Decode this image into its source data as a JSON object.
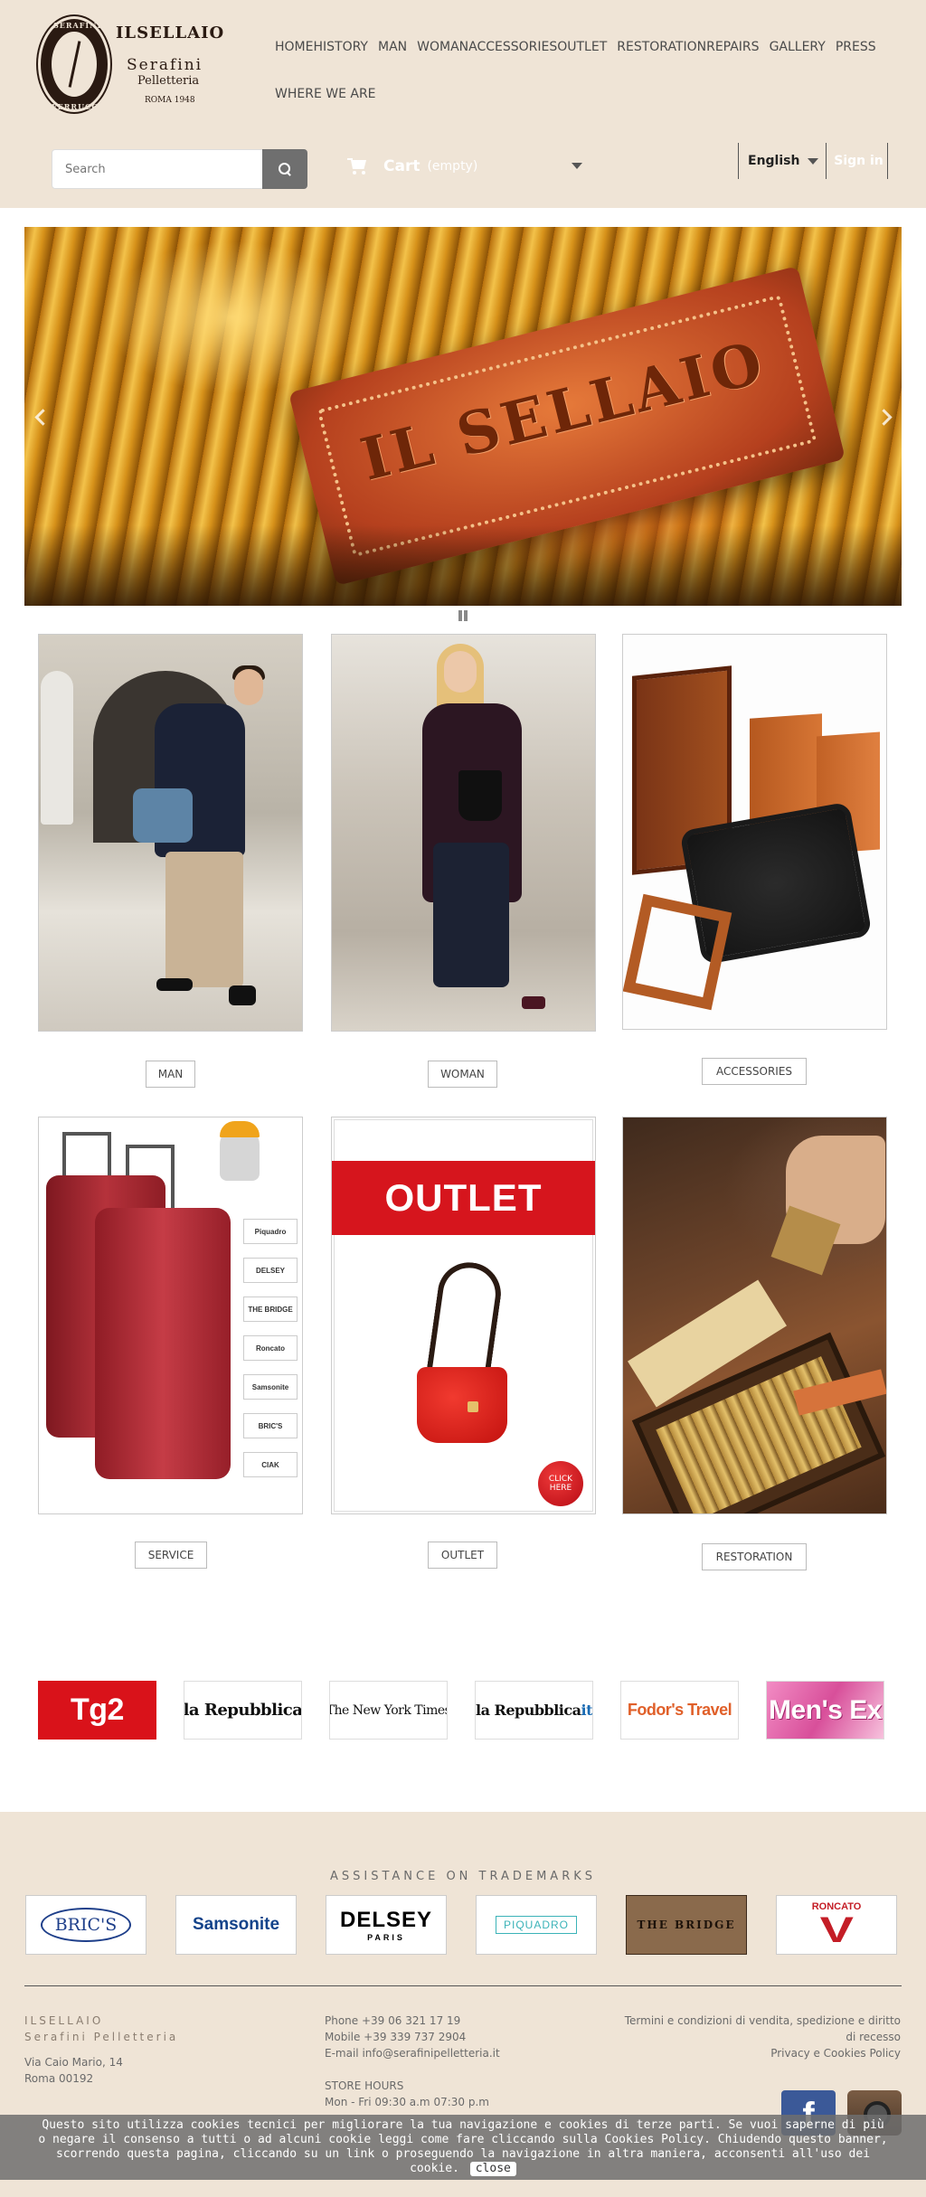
{
  "header": {
    "logo": {
      "brand": "ILSELLAIO",
      "seal_top": "SERAFINI",
      "seal_bottom": "FERRUCCIO",
      "sub1": "Serafini",
      "sub2": "Pelletteria",
      "sub3": "ROMA 1948"
    },
    "nav_row1": [
      "HOME",
      "HISTORY",
      "MAN",
      "WOMAN",
      "ACCESSORIES",
      "OUTLET",
      "RESTORATION",
      "REPAIRS",
      "GALLERY",
      "PRESS"
    ],
    "nav_row2": [
      "WHERE WE ARE"
    ],
    "search": {
      "placeholder": "Search",
      "icon": "search-icon"
    },
    "cart": {
      "label": "Cart",
      "status": "(empty)",
      "icon": "cart-icon"
    },
    "language": {
      "selected": "English"
    },
    "signin_label": "Sign in",
    "colors": {
      "header_bg": "#efe4d6"
    }
  },
  "hero": {
    "slide_text": "IL SELLAIO",
    "prev_icon": "chevron-left-icon",
    "next_icon": "chevron-right-icon",
    "pause_icon": "pause-icon"
  },
  "categories": [
    {
      "label": "MAN"
    },
    {
      "label": "WOMAN"
    },
    {
      "label": "ACCESSORIES"
    },
    {
      "label": "SERVICE"
    },
    {
      "label": "OUTLET"
    },
    {
      "label": "RESTORATION"
    }
  ],
  "service_image": {
    "brands": [
      "Piquadro",
      "DELSEY",
      "THE BRIDGE",
      "Roncato",
      "Samsonite",
      "BRIC'S",
      "CIAK"
    ]
  },
  "outlet_image": {
    "banner": "OUTLET",
    "badge": "CLICK HERE"
  },
  "press": [
    {
      "name": "Tg2"
    },
    {
      "name": "la Repubblica"
    },
    {
      "name": "The New York Times"
    },
    {
      "name": "la Repubblica",
      "suffix": "it"
    },
    {
      "name": "Fodor's Travel"
    },
    {
      "name": "Men's Ex"
    }
  ],
  "footer": {
    "assist_title": "ASSISTANCE ON TRADEMARKS",
    "trademarks": [
      {
        "name": "BRIC'S"
      },
      {
        "name": "Samsonite"
      },
      {
        "name": "DELSEY",
        "sub": "PARIS"
      },
      {
        "name": "PIQUADRO"
      },
      {
        "name": "THE BRIDGE"
      },
      {
        "name": "RONCATO"
      }
    ],
    "address": {
      "brand1": "ILSELLAIO",
      "brand2": "Serafini Pelletteria",
      "street": "Via Caio Mario, 14",
      "city": "Roma 00192"
    },
    "contact": {
      "phone": "Phone +39 06 321 17 19",
      "mobile": "Mobile +39 339 737 2904",
      "email": "E-mail info@serafinipelletteria.it",
      "hours_title": "STORE HOURS",
      "hours": "Mon - Fri 09:30 a.m 07:30 p.m"
    },
    "legal": {
      "terms": "Termini e condizioni di vendita, spedizione e diritto di recesso",
      "privacy": "Privacy e Cookies Policy"
    },
    "social": {
      "facebook_icon": "facebook-icon",
      "instagram_icon": "instagram-icon"
    }
  },
  "cookie_banner": {
    "text_before": "Questo sito utilizza cookies tecnici per migliorare la tua navigazione e cookies di terze parti. Se vuoi saperne di più o negare il consenso a tutti o ad alcuni cookie leggi come fare cliccando sulla ",
    "policy_link": "Cookies Policy",
    "text_after": ". Chiudendo questo banner, scorrendo questa pagina, cliccando su un link o proseguendo la navigazione in altra maniera, acconsenti all'uso dei cookie.",
    "close_label": "close"
  }
}
